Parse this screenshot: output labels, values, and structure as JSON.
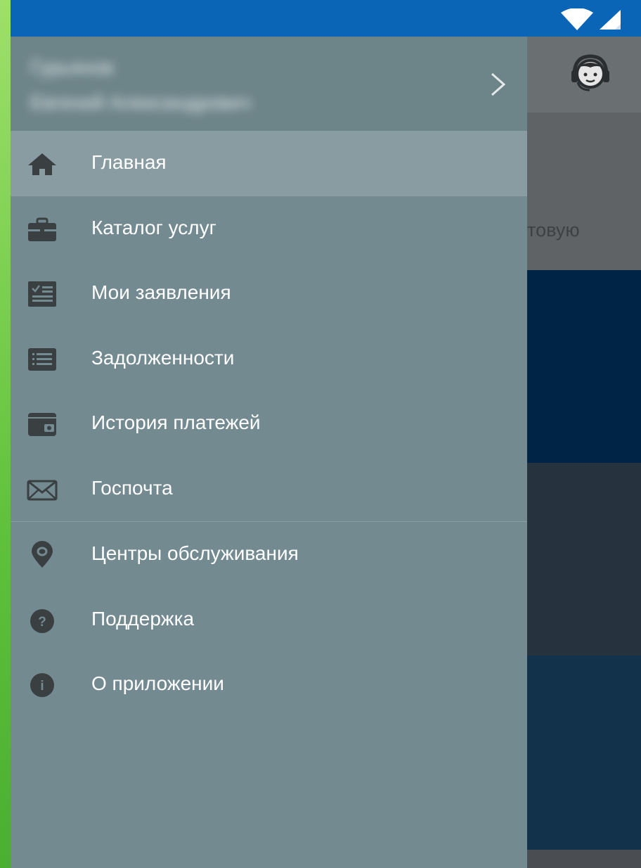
{
  "status_bar": {
    "wifi_icon": "wifi-icon",
    "signal_icon": "cell-signal-icon"
  },
  "background_app": {
    "support_icon": "support-headset-icon",
    "banner_text_fragment": "товую"
  },
  "drawer": {
    "header": {
      "user_name": "Гурьянов",
      "user_fullname": "Евгений Александрович",
      "chevron_icon": "chevron-right-icon"
    },
    "items": [
      {
        "label": "Главная",
        "icon": "home-icon",
        "active": true
      },
      {
        "label": "Каталог услуг",
        "icon": "briefcase-icon"
      },
      {
        "label": "Мои заявления",
        "icon": "applications-icon"
      },
      {
        "label": "Задолженности",
        "icon": "list-icon"
      },
      {
        "label": "История платежей",
        "icon": "wallet-icon"
      },
      {
        "label": "Госпочта",
        "icon": "mail-icon"
      },
      {
        "label": "Центры обслуживания",
        "icon": "location-pin-icon"
      },
      {
        "label": "Поддержка",
        "icon": "help-icon"
      },
      {
        "label": "О приложении",
        "icon": "info-icon"
      }
    ]
  },
  "colors": {
    "status_bar": "#0a65b6",
    "drawer_bg": "#738a90",
    "drawer_header_bg": "#6d8489",
    "active_item_bg": "#889ca2",
    "icon_color": "#3a3f42",
    "label_color": "#ffffff"
  }
}
